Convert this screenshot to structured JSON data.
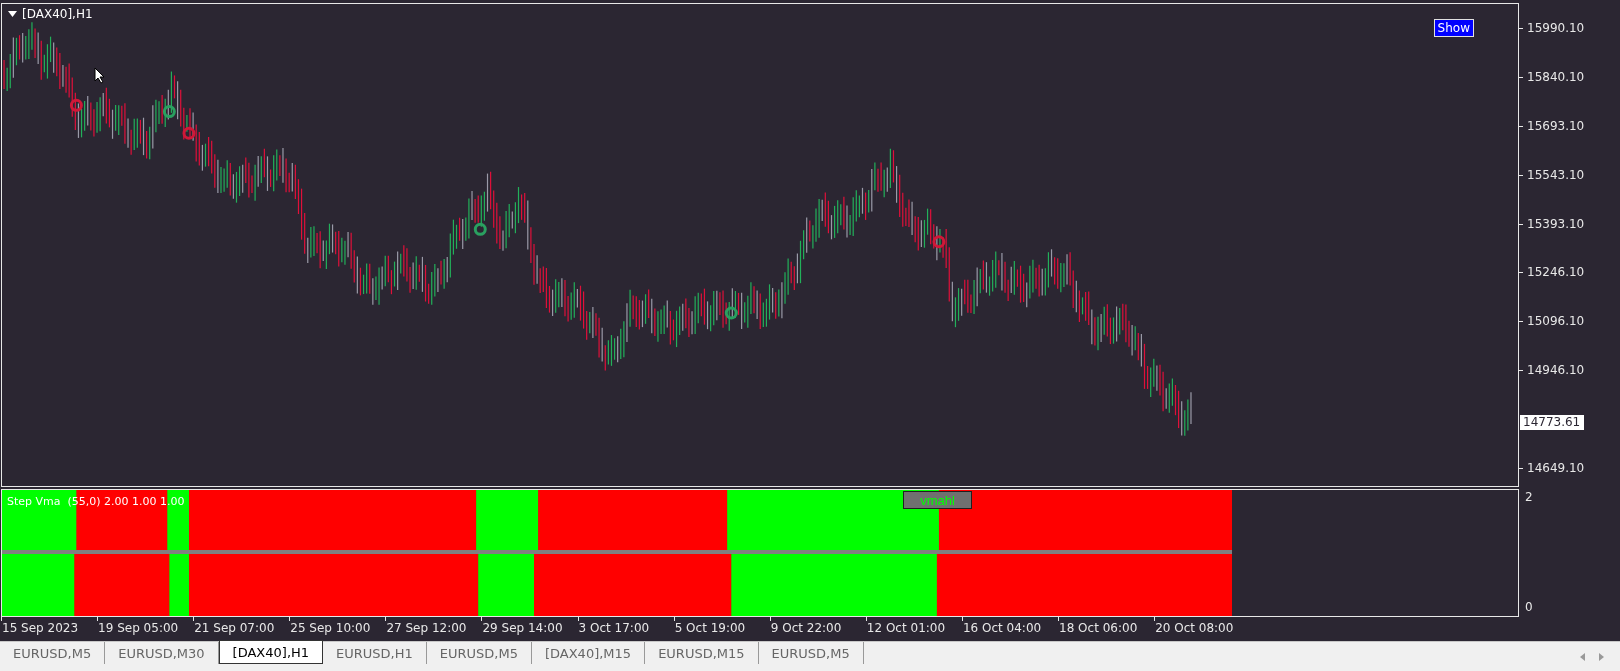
{
  "chart": {
    "title": "[DAX40],H1",
    "show_button": "Show",
    "price_axis": [
      "15990.10",
      "15840.10",
      "15693.10",
      "15543.10",
      "15393.10",
      "15246.10",
      "15096.10",
      "14946.10"
    ],
    "current_price": "14773.61",
    "price_axis_lower": [
      "14649.10"
    ]
  },
  "indicator": {
    "label": "Step Vma  (55,0) 2.00 1.00 1.00",
    "button": "vmahl",
    "axis": [
      "2",
      "0"
    ]
  },
  "time_axis": [
    "15 Sep 2023",
    "19 Sep 05:00",
    "21 Sep 07:00",
    "25 Sep 10:00",
    "27 Sep 12:00",
    "29 Sep 14:00",
    "3 Oct 17:00",
    "5 Oct 19:00",
    "9 Oct 22:00",
    "12 Oct 01:00",
    "16 Oct 04:00",
    "18 Oct 06:00",
    "20 Oct 08:00"
  ],
  "tabs": [
    {
      "label": "EURUSD,M5",
      "selected": false
    },
    {
      "label": "EURUSD,M30",
      "selected": false
    },
    {
      "label": "[DAX40],H1",
      "selected": true
    },
    {
      "label": "EURUSD,H1",
      "selected": false
    },
    {
      "label": "EURUSD,M5",
      "selected": false
    },
    {
      "label": "[DAX40],M15",
      "selected": false
    },
    {
      "label": "EURUSD,M15",
      "selected": false
    },
    {
      "label": "EURUSD,M5",
      "selected": false
    }
  ]
}
